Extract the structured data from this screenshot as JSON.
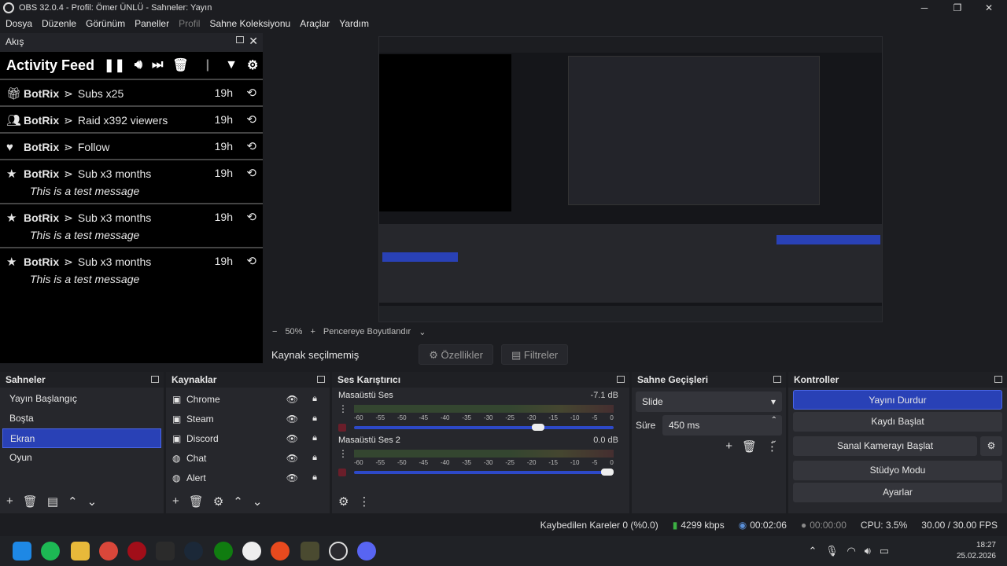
{
  "window": {
    "title": "OBS 32.0.4 - Profil: Ömer ÜNLÜ - Sahneler: Yayın",
    "min_icon": "minimize-icon",
    "max_icon": "maximize-icon",
    "close_icon": "close-icon"
  },
  "menu": [
    "Dosya",
    "Düzenle",
    "Görünüm",
    "Paneller",
    "Profil",
    "Sahne Koleksiyonu",
    "Araçlar",
    "Yardım"
  ],
  "akis": {
    "title": "Akış",
    "feed_title": "Activity Feed",
    "items": [
      {
        "icon": "gift-icon",
        "name": "BotRix",
        "sep": "⋗",
        "text": "Subs x25",
        "time": "19h",
        "message": ""
      },
      {
        "icon": "raid-icon",
        "name": "BotRix",
        "sep": "⋗",
        "text": "Raid x392 viewers",
        "time": "19h",
        "message": ""
      },
      {
        "icon": "heart-icon",
        "name": "BotRix",
        "sep": "⋗",
        "text": "Follow",
        "time": "19h",
        "message": ""
      },
      {
        "icon": "star-icon",
        "name": "BotRix",
        "sep": "⋗",
        "text": "Sub x3 months",
        "time": "19h",
        "message": "This is a test message"
      },
      {
        "icon": "star-icon",
        "name": "BotRix",
        "sep": "⋗",
        "text": "Sub x3 months",
        "time": "19h",
        "message": "This is a test message"
      },
      {
        "icon": "star-icon",
        "name": "BotRix",
        "sep": "⋗",
        "text": "Sub x3 months",
        "time": "19h",
        "message": "This is a test message"
      }
    ]
  },
  "preview": {
    "zoom": "50%",
    "fit_label": "Pencereye Boyutlandır",
    "no_source": "Kaynak seçilmemiş",
    "properties": "Özellikler",
    "filters": "Filtreler"
  },
  "scenes": {
    "title": "Sahneler",
    "items": [
      "Yayın Başlangıç",
      "Boşta",
      "Ekran",
      "Oyun"
    ],
    "selected": "Ekran"
  },
  "sources": {
    "title": "Kaynaklar",
    "items": [
      {
        "name": "Chrome",
        "icon": "window-capture-icon"
      },
      {
        "name": "Steam",
        "icon": "window-capture-icon"
      },
      {
        "name": "Discord",
        "icon": "window-capture-icon"
      },
      {
        "name": "Chat",
        "icon": "browser-icon"
      },
      {
        "name": "Alert",
        "icon": "browser-icon"
      }
    ]
  },
  "mixer": {
    "title": "Ses Karıştırıcı",
    "channels": [
      {
        "name": "Masaüstü Ses",
        "db": "-7.1 dB",
        "volume": 0.72
      },
      {
        "name": "Masaüstü Ses 2",
        "db": "0.0 dB",
        "volume": 1.0
      }
    ],
    "ticks": [
      "-60",
      "-55",
      "-50",
      "-45",
      "-40",
      "-35",
      "-30",
      "-25",
      "-20",
      "-15",
      "-10",
      "-5",
      "0"
    ]
  },
  "transitions": {
    "title": "Sahne Geçişleri",
    "selected": "Slide",
    "duration_label": "Süre",
    "duration": "450 ms"
  },
  "controls": {
    "title": "Kontroller",
    "buttons": [
      "Yayını Durdur",
      "Kaydı Başlat",
      "Sanal Kamerayı Başlat",
      "Stüdyo Modu",
      "Ayarlar"
    ]
  },
  "status": {
    "dropped": "Kaybedilen Kareler 0 (%0.0)",
    "bitrate": "4299 kbps",
    "stream_time": "00:02:06",
    "rec_time": "00:00:00",
    "cpu": "CPU: 3.5%",
    "fps": "30.00 / 30.00 FPS"
  },
  "taskbar": {
    "time": "18:27",
    "date": "25.02.2026"
  },
  "colors": {
    "accent": "#2941b6",
    "panel": "#26272c",
    "background": "#1c1d21"
  }
}
